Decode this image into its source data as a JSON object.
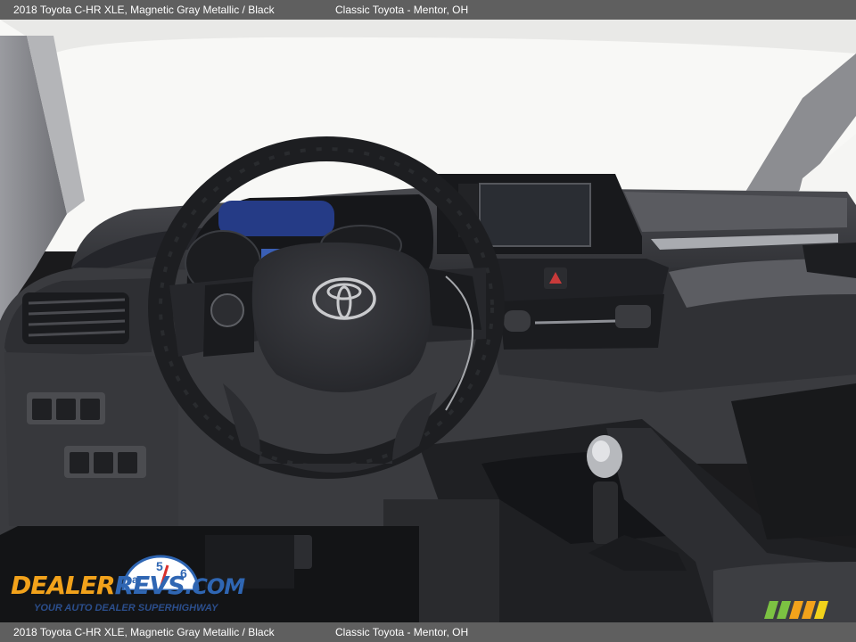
{
  "caption": {
    "vehicle": "2018 Toyota C-HR XLE,  Magnetic Gray Metallic / Black",
    "dealer": "Classic Toyota - Mentor, OH"
  },
  "watermark": {
    "brand_word_1": "DEALER",
    "brand_word_2": "REVS",
    "brand_suffix": ".COM",
    "tagline": "YOUR AUTO DEALER SUPERHIGHWAY",
    "gauge_digits": "a 5 6",
    "colors": {
      "orange": "#f2a21b",
      "blue": "#2f66b3",
      "green": "#7cc242"
    }
  },
  "photo": {
    "subject": "vehicle-interior",
    "emblem": "toyota-logo",
    "colors": {
      "dash": "#3a3b3f",
      "trim": "#8e9096",
      "window": "#f8f8f6"
    }
  }
}
